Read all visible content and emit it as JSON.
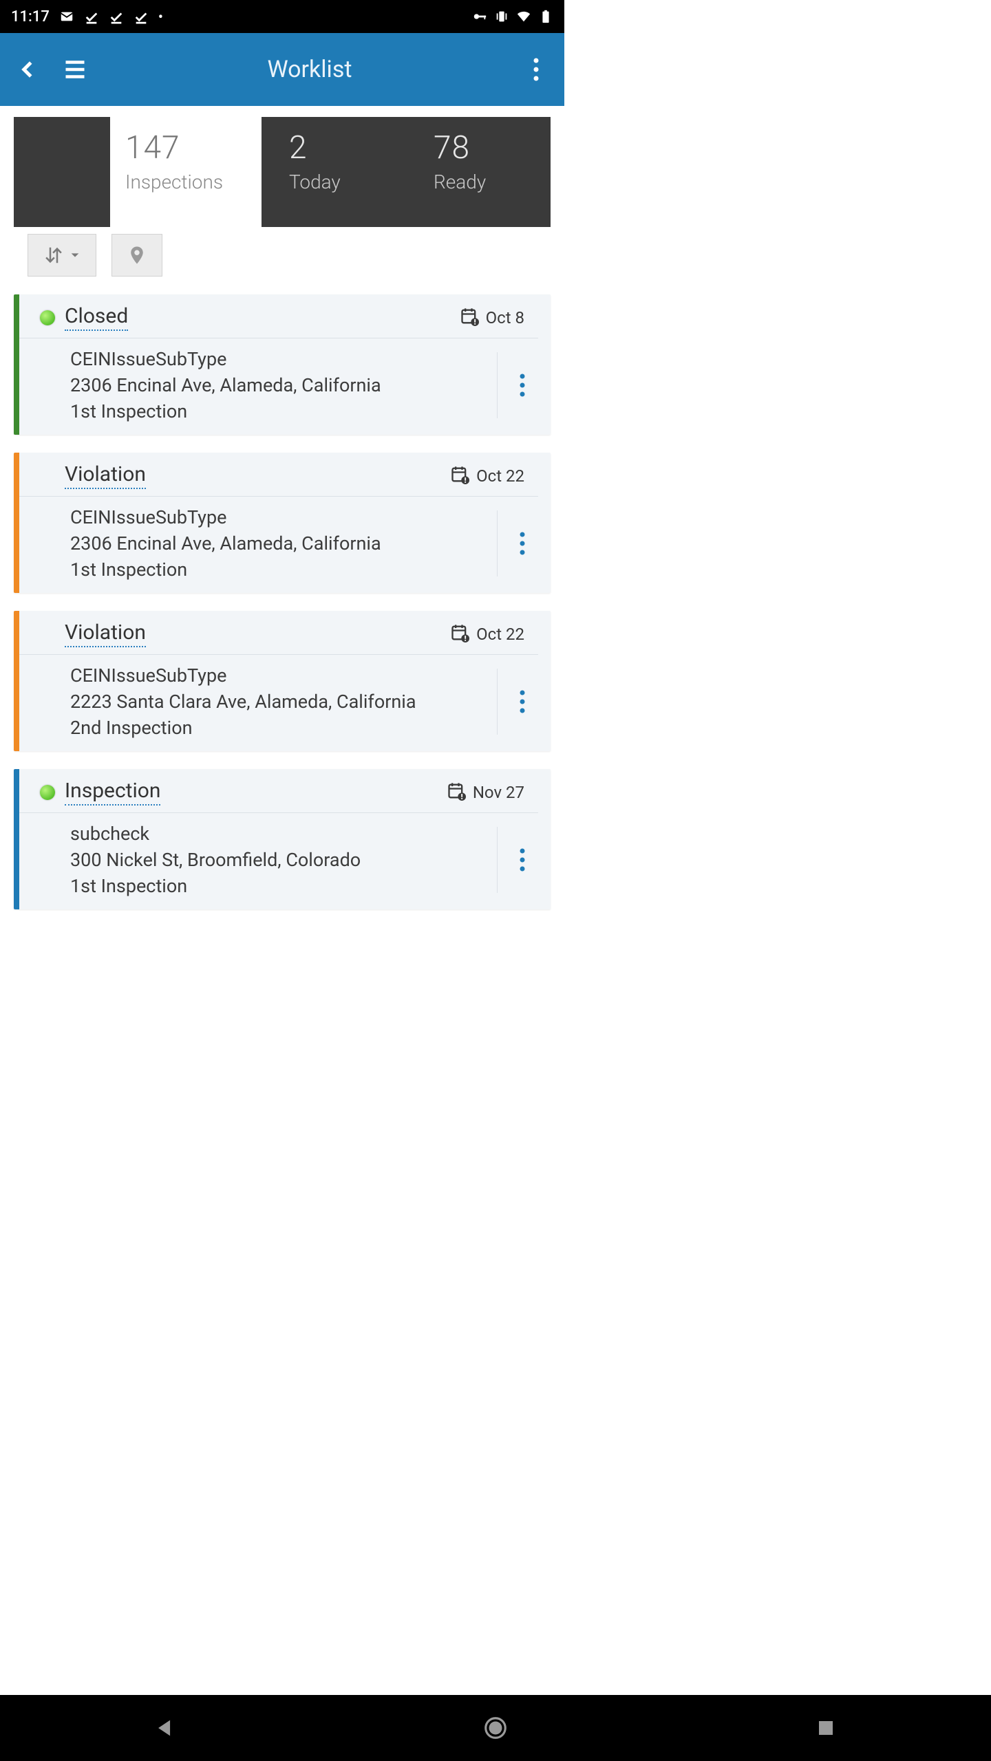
{
  "status_bar": {
    "time": "11:17"
  },
  "app_bar": {
    "title": "Worklist"
  },
  "summary": {
    "inspections_value": "147",
    "inspections_label": "Inspections",
    "today_value": "2",
    "today_label": "Today",
    "ready_value": "78",
    "ready_label": "Ready"
  },
  "cards": [
    {
      "stripe": "green",
      "has_dot": true,
      "status": "Closed",
      "date": "Oct 8",
      "sub_type": "CEINIssueSubType",
      "address": "2306 Encinal Ave, Alameda, California",
      "inspection": "1st Inspection"
    },
    {
      "stripe": "orange",
      "has_dot": false,
      "status": "Violation",
      "date": "Oct 22",
      "sub_type": "CEINIssueSubType",
      "address": "2306 Encinal Ave, Alameda, California",
      "inspection": "1st Inspection"
    },
    {
      "stripe": "orange",
      "has_dot": false,
      "status": "Violation",
      "date": "Oct 22",
      "sub_type": "CEINIssueSubType",
      "address": "2223 Santa Clara Ave, Alameda, California",
      "inspection": "2nd Inspection"
    },
    {
      "stripe": "blue",
      "has_dot": true,
      "status": "Inspection",
      "date": "Nov 27",
      "sub_type": "subcheck",
      "address": "300 Nickel St, Broomfield, Colorado",
      "inspection": "1st Inspection"
    }
  ]
}
